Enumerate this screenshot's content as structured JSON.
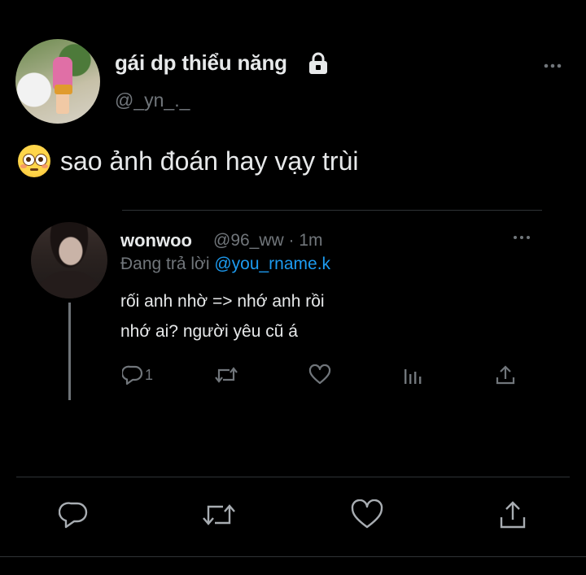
{
  "author": {
    "name": "gái dp thiểu năng",
    "handle": "@_yn_._",
    "avatar_icon": "user-avatar",
    "protected_icon": "lock-icon"
  },
  "tweet": {
    "emoji_icon": "flushed-face-emoji",
    "text": "sao ảnh đoán hay vạy trùi"
  },
  "reply": {
    "name": "wonwoo",
    "meta": "@96_ww · 1m",
    "replying_prefix": "Đang trả lời ",
    "replying_to": "@you_rname.k",
    "line1": "rối anh nhờ => nhớ anh rồi",
    "line2": "nhớ ai? người yêu cũ á",
    "reply_count": "1"
  },
  "colors": {
    "background": "#000000",
    "text_primary": "#e7e9ea",
    "text_secondary": "#71767b",
    "link": "#1d9bf0",
    "divider": "#2f3336"
  }
}
